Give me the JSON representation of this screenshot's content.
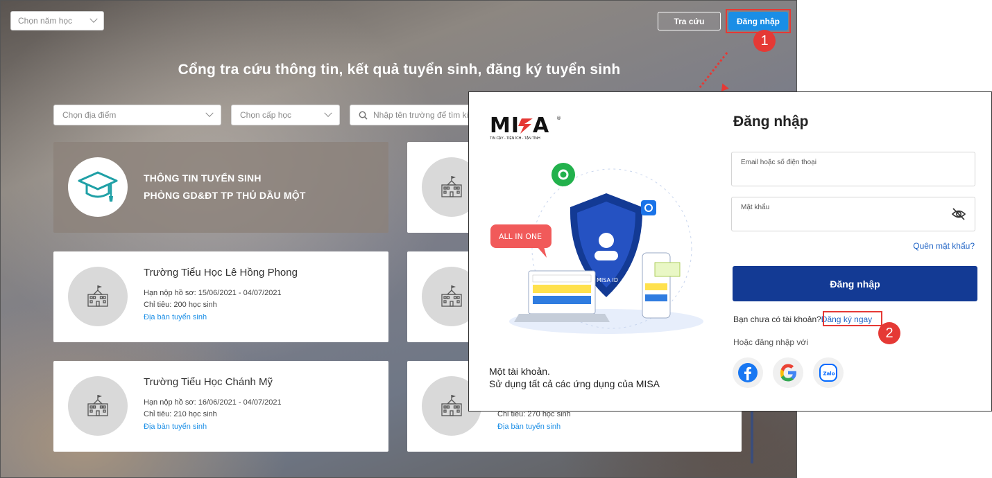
{
  "top_bar": {
    "year_select": "Chọn năm học",
    "lookup_button": "Tra cứu",
    "login_button": "Đăng nhập"
  },
  "hero": {
    "title": "Cổng tra cứu thông tin, kết quả tuyển sinh, đăng ký tuyển sinh"
  },
  "filters": {
    "location_placeholder": "Chọn địa điểm",
    "level_placeholder": "Chọn cấp học",
    "search_placeholder": "Nhập tên trường để tìm ki"
  },
  "featured_card": {
    "line1": "THÔNG TIN TUYỂN SINH",
    "line2": "PHÒNG GD&ĐT TP THỦ DẦU MỘT"
  },
  "school_cards": [
    {
      "name": "Trường Tiểu Học Lê Hồng Phong",
      "deadline": "Hạn nộp hồ sơ: 15/06/2021 - 04/07/2021",
      "quota": "Chỉ tiêu: 200 học sinh",
      "area_link": "Địa bàn tuyển sinh"
    },
    {
      "name": "Trường Tiểu Học Chánh Mỹ",
      "deadline": "Hạn nộp hồ sơ: 16/06/2021 - 04/07/2021",
      "quota": "Chỉ tiêu: 210 học sinh",
      "area_link": "Địa bàn tuyển sinh"
    },
    {
      "quota": "Chỉ tiêu: 270 học sinh",
      "area_link": "Địa bàn tuyển sinh"
    }
  ],
  "annotations": {
    "step1": "1",
    "step2": "2",
    "color": "#e53935"
  },
  "login_dialog": {
    "brand": "MISA",
    "brand_sub": "TIN CẬY - TIỆN ÍCH - TẬN TÌNH",
    "illustration_badge": "ALL IN ONE",
    "illustration_id": "MISA ID",
    "tagline_1": "Một tài khoản.",
    "tagline_2": "Sử dụng tất cả các ứng dụng của MISA",
    "title": "Đăng nhập",
    "email_label": "Email hoặc số điện thoại",
    "password_label": "Mật khẩu",
    "forgot_password": "Quên mật khẩu?",
    "submit": "Đăng nhập",
    "no_account": "Bạn chưa có tài khoản?",
    "register": "Đăng ký ngay",
    "or_login_with": "Hoặc đăng nhập với",
    "social_zalo": "Zalo",
    "accent": "#133a94"
  }
}
